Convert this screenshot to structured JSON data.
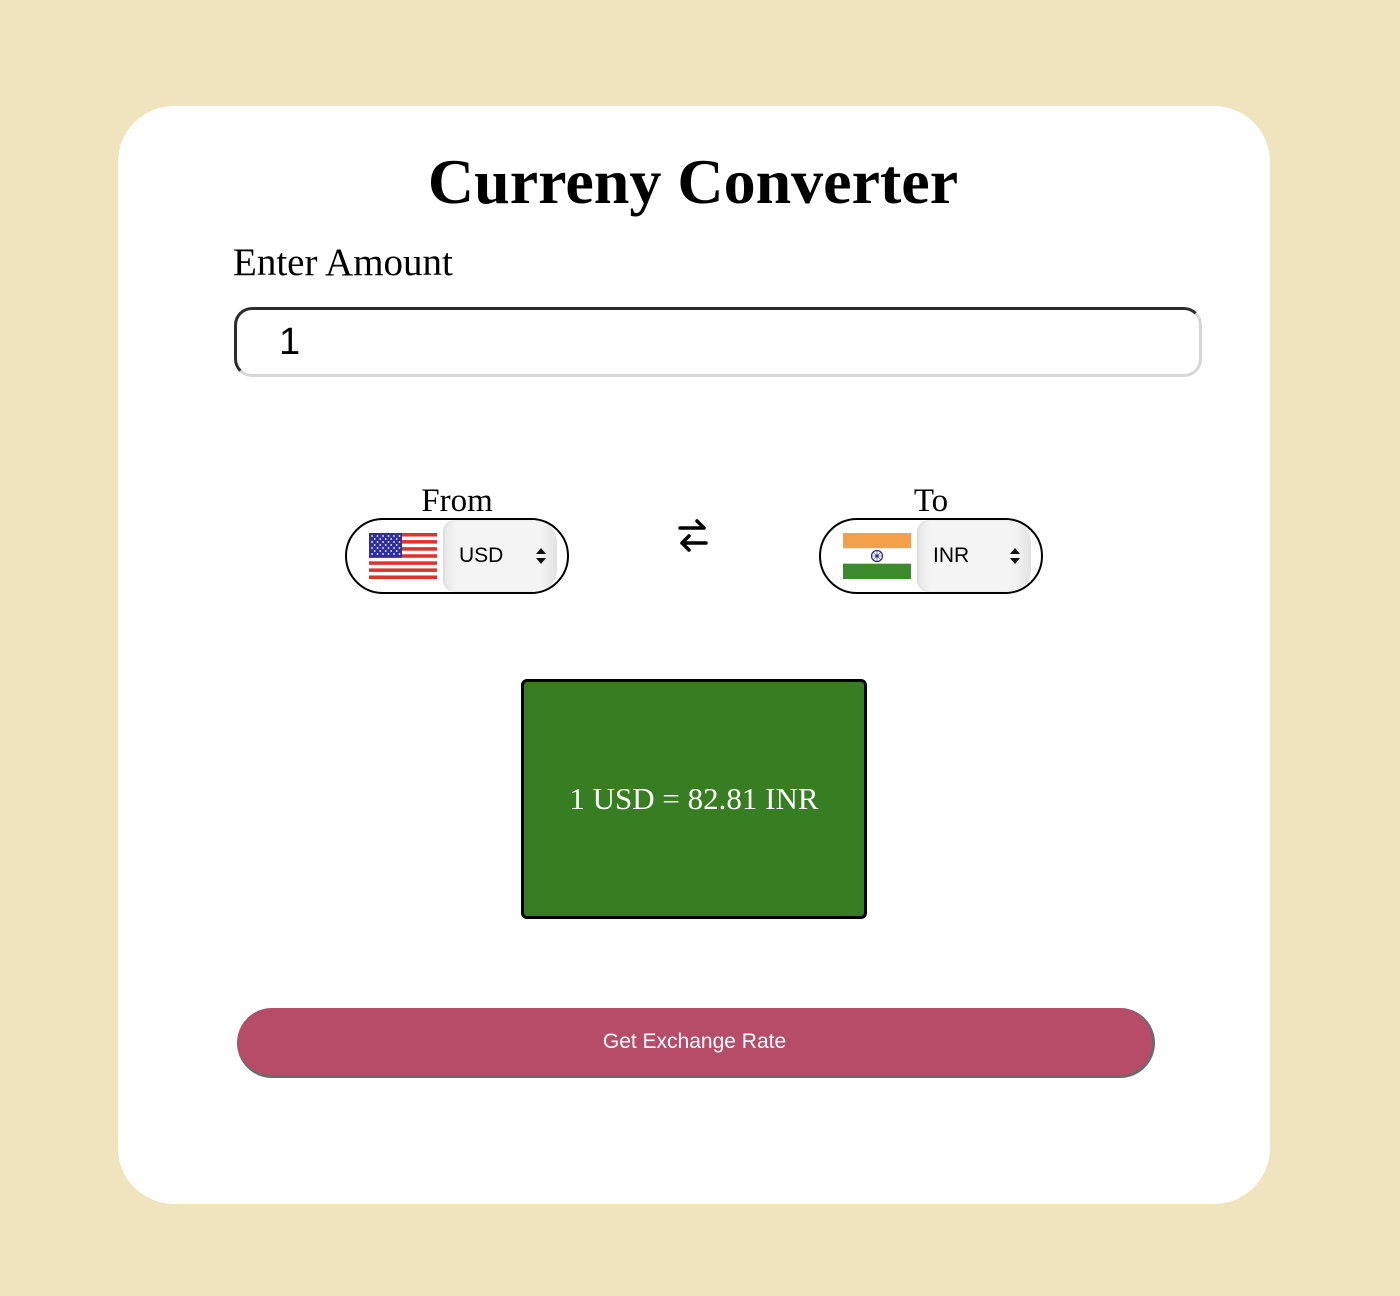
{
  "header": {
    "title": "Curreny Converter"
  },
  "amount": {
    "label": "Enter Amount",
    "value": "1"
  },
  "from": {
    "label": "From",
    "selected": "USD",
    "flag": "us-flag"
  },
  "to": {
    "label": "To",
    "selected": "INR",
    "flag": "india-flag"
  },
  "swap": {
    "icon": "swap-arrows-icon"
  },
  "result": {
    "text": "1 USD = 82.81 INR",
    "background": "#377d22"
  },
  "action": {
    "label": "Get Exchange Rate",
    "color": "#b74c69"
  },
  "colors": {
    "page_background": "#f0e4bf",
    "card_background": "#ffffff"
  }
}
